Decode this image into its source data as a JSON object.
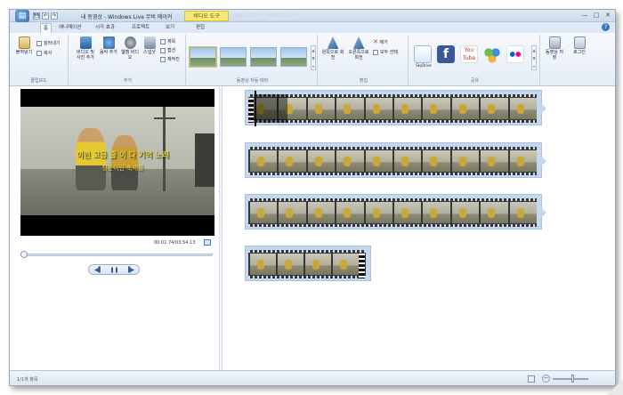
{
  "window": {
    "title": "내 동영상 - Windows Live 무비 메이커",
    "context_tab": "비디오 도구",
    "faded_tab_1": "동영상 도구",
    "faded_tab_2": "텍스트 도구",
    "buttons": {
      "minimize": "—",
      "maximize": "□",
      "close": "✕"
    }
  },
  "quick_access": [
    "💾",
    "↶",
    "↷"
  ],
  "menu_tabs": [
    "홈",
    "애니메이션",
    "시각 효과",
    "프로젝트",
    "보기",
    "편집"
  ],
  "ribbon": {
    "clipboard": {
      "label": "클립보드",
      "paste": "붙여넣기",
      "cut": "잘라내기",
      "copy": "복사"
    },
    "add": {
      "label": "추가",
      "add_video_photo": "비디오 및 사진 추가",
      "add_music": "음악 추가",
      "record_narration": "웹캠 비디오",
      "snapshot": "스냅샷",
      "title": "제목",
      "caption": "캡션",
      "credits": "제작진"
    },
    "themes": {
      "label": "동영상 자동 테마",
      "count": 5
    },
    "editing": {
      "label": "편집",
      "rotate_left": "왼쪽으로 회전",
      "rotate_right": "오른쪽으로 회전",
      "remove": "제거",
      "select_all": "모두 선택"
    },
    "share": {
      "label": "공유",
      "services": [
        {
          "name": "SkyDrive",
          "icon": "skydrive-icon",
          "color": "#2f7fd6"
        },
        {
          "name": "f",
          "icon": "facebook-icon",
          "color": "#3b5998"
        },
        {
          "name": "You Tube",
          "icon": "youtube-icon",
          "color": "#c4302b"
        },
        {
          "name": "",
          "icon": "messenger-icon",
          "color": "#5fa84a"
        },
        {
          "name": "",
          "icon": "flickr-icon",
          "color": "#ff0084"
        }
      ],
      "save_movie": "동영상 저장",
      "sign_in": "로그인"
    }
  },
  "preview": {
    "subtitle_line1": "이런 고급 줄 이 다 기억 노래",
    "subtitle_line2": "청춘이란 축제를",
    "timecode": "00:01.74/03:54.13"
  },
  "playback": {
    "prev": "◀▌",
    "play": "❚❚",
    "next": "▐▶"
  },
  "storyboard": {
    "clip_count": 4
  },
  "status": {
    "text": "1/1개 항목"
  }
}
